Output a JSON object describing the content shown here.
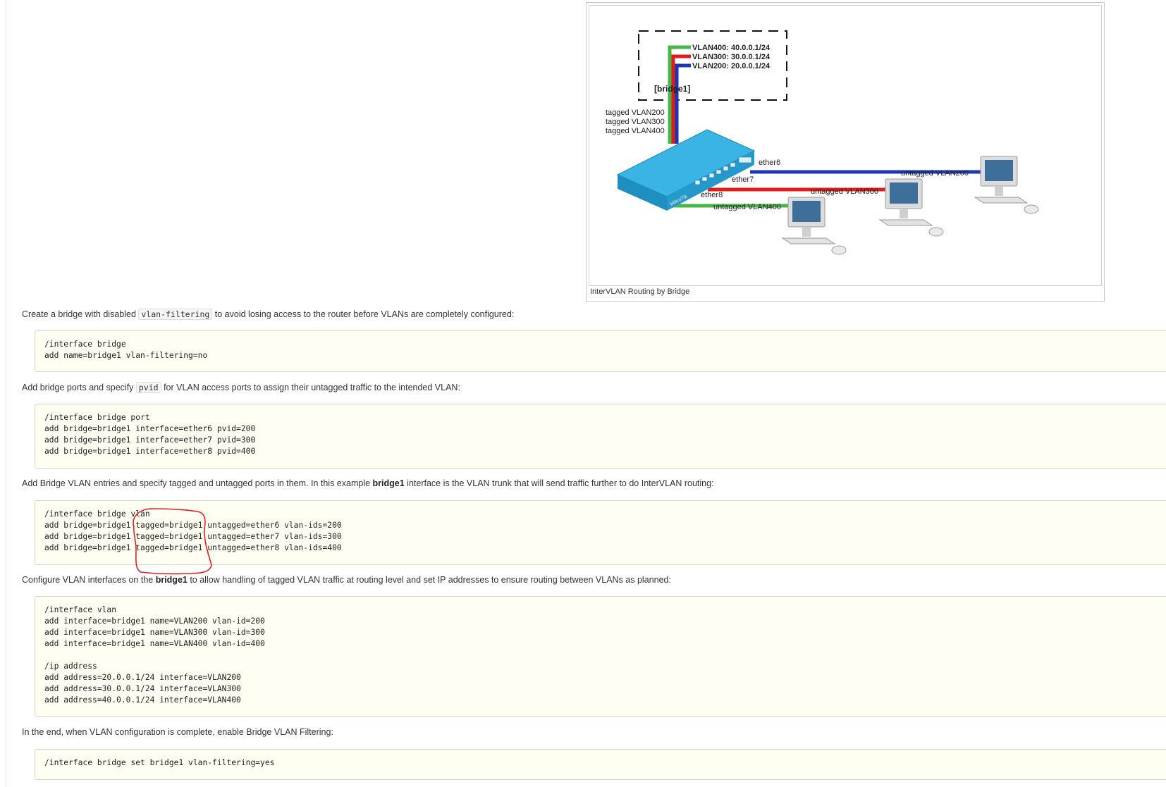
{
  "diagram": {
    "caption": "InterVLAN Routing by Bridge",
    "bridge_label": "[bridge1]",
    "vlan_ips": [
      "VLAN400: 40.0.0.1/24",
      "VLAN300: 30.0.0.1/24",
      "VLAN200: 20.0.0.1/24"
    ],
    "trunk_labels": [
      "tagged VLAN200",
      "tagged VLAN300",
      "tagged VLAN400"
    ],
    "ports": [
      "ether6",
      "ether7",
      "ether8"
    ],
    "access_labels": [
      "untagged VLAN200",
      "untagged VLAN300",
      "untagged VLAN400"
    ],
    "switch_brand": "MikroTik",
    "colors": {
      "vlan200": "#1f35b4",
      "vlan300": "#e01d1d",
      "vlan400": "#46b848",
      "switch": "#2a9fd0"
    }
  },
  "sections": {
    "s1": {
      "pre": "Create a bridge with disabled ",
      "code": "vlan-filtering",
      "post": " to avoid losing access to the router before VLANs are completely configured:"
    },
    "s2": {
      "pre": "Add bridge ports and specify ",
      "code": "pvid",
      "post": " for VLAN access ports to assign their untagged traffic to the intended VLAN:"
    },
    "s3": {
      "pre": "Add Bridge VLAN entries and specify tagged and untagged ports in them. In this example ",
      "bold": "bridge1",
      "post": " interface is the VLAN trunk that will send traffic further to do InterVLAN routing:"
    },
    "s4": {
      "pre": "Configure VLAN interfaces on the ",
      "bold": "bridge1",
      "post": " to allow handling of tagged VLAN traffic at routing level and set IP addresses to ensure routing between VLANs as planned:"
    },
    "s5": {
      "text": "In the end, when VLAN configuration is complete, enable Bridge VLAN Filtering:"
    }
  },
  "code_blocks": {
    "c1": [
      "/interface bridge",
      "add name=bridge1 vlan-filtering=no"
    ],
    "c2": [
      "/interface bridge port",
      "add bridge=bridge1 interface=ether6 pvid=200",
      "add bridge=bridge1 interface=ether7 pvid=300",
      "add bridge=bridge1 interface=ether8 pvid=400"
    ],
    "c3": [
      "/interface bridge vlan",
      "add bridge=bridge1 tagged=bridge1 untagged=ether6 vlan-ids=200",
      "add bridge=bridge1 tagged=bridge1 untagged=ether7 vlan-ids=300",
      "add bridge=bridge1 tagged=bridge1 untagged=ether8 vlan-ids=400"
    ],
    "c4": [
      "/interface vlan",
      "add interface=bridge1 name=VLAN200 vlan-id=200",
      "add interface=bridge1 name=VLAN300 vlan-id=300",
      "add interface=bridge1 name=VLAN400 vlan-id=400",
      "",
      "/ip address",
      "add address=20.0.0.1/24 interface=VLAN200",
      "add address=30.0.0.1/24 interface=VLAN300",
      "add address=40.0.0.1/24 interface=VLAN400"
    ],
    "c5": [
      "/interface bridge set bridge1 vlan-filtering=yes"
    ]
  }
}
